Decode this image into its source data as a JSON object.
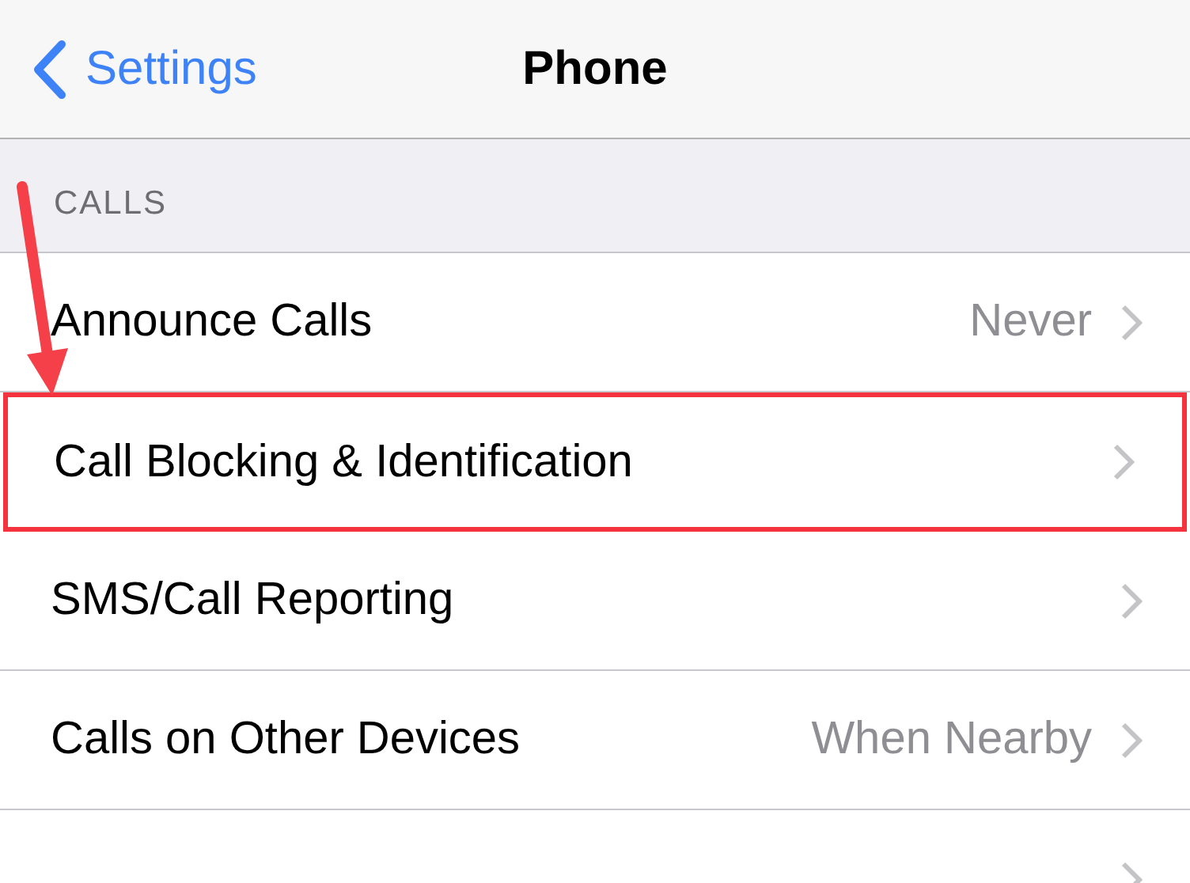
{
  "nav": {
    "back": "Settings",
    "title": "Phone"
  },
  "section": {
    "header": "CALLS",
    "rows": [
      {
        "label": "Announce Calls",
        "value": "Never",
        "highlighted": false
      },
      {
        "label": "Call Blocking & Identification",
        "highlighted": true
      },
      {
        "label": "SMS/Call Reporting",
        "highlighted": false
      },
      {
        "label": "Calls on Other Devices",
        "value": "When Nearby",
        "highlighted": false
      },
      {
        "highlighted": false
      }
    ]
  }
}
